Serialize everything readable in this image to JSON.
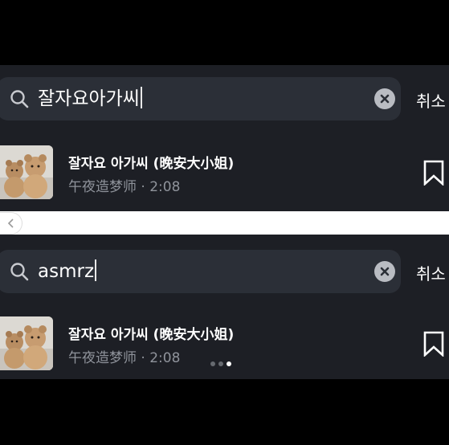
{
  "top": {
    "search": {
      "query": "잘자요아가씨"
    },
    "cancel_label": "취소",
    "result": {
      "title": "잘자요 아가씨 (晚安大小姐)",
      "subtitle": "午夜造梦师 · 2:08"
    }
  },
  "bottom": {
    "search": {
      "query": "asmrz"
    },
    "cancel_label": "취소",
    "result": {
      "title": "잘자요 아가씨 (晚安大小姐)",
      "subtitle": "午夜造梦师 · 2:08"
    }
  },
  "pager": {
    "dot_count": 3,
    "active_index": 2
  },
  "icons": [
    "search-icon",
    "clear-icon",
    "bookmark-icon",
    "chevron-left-icon"
  ],
  "colors": {
    "panel": "#1d1f25",
    "search_bg": "#2b2f37",
    "subtitle": "#8f939b"
  }
}
